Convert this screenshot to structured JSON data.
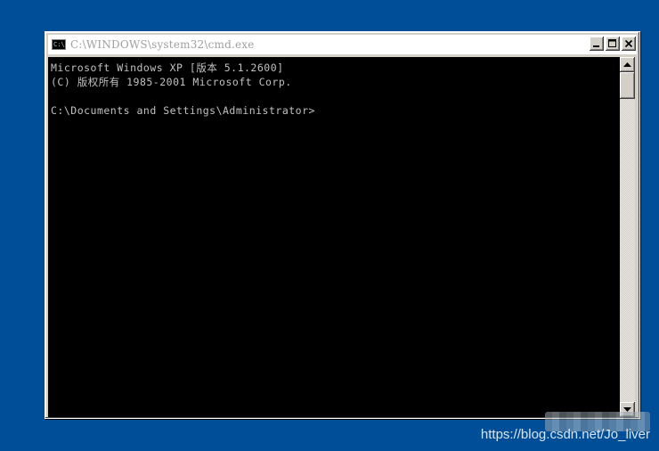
{
  "window": {
    "title": "C:\\WINDOWS\\system32\\cmd.exe",
    "icon_label": "C:\\",
    "icon": "console-window-icon",
    "controls": {
      "minimize_icon": "minimize-icon",
      "maximize_icon": "maximize-icon",
      "close_icon": "close-icon"
    }
  },
  "console": {
    "lines": [
      "Microsoft Windows XP [版本 5.1.2600]",
      "(C) 版权所有 1985-2001 Microsoft Corp.",
      "",
      "C:\\Documents and Settings\\Administrator>"
    ]
  },
  "scrollbar": {
    "up_icon": "scroll-up-arrow-icon",
    "down_icon": "scroll-down-arrow-icon"
  },
  "watermark": {
    "text": "https://blog.csdn.net/Jo_liver"
  },
  "colors": {
    "desktop_background": "#004e98",
    "console_background": "#000000",
    "console_text": "#c0c0c0",
    "window_frame": "#d4d0c8"
  }
}
